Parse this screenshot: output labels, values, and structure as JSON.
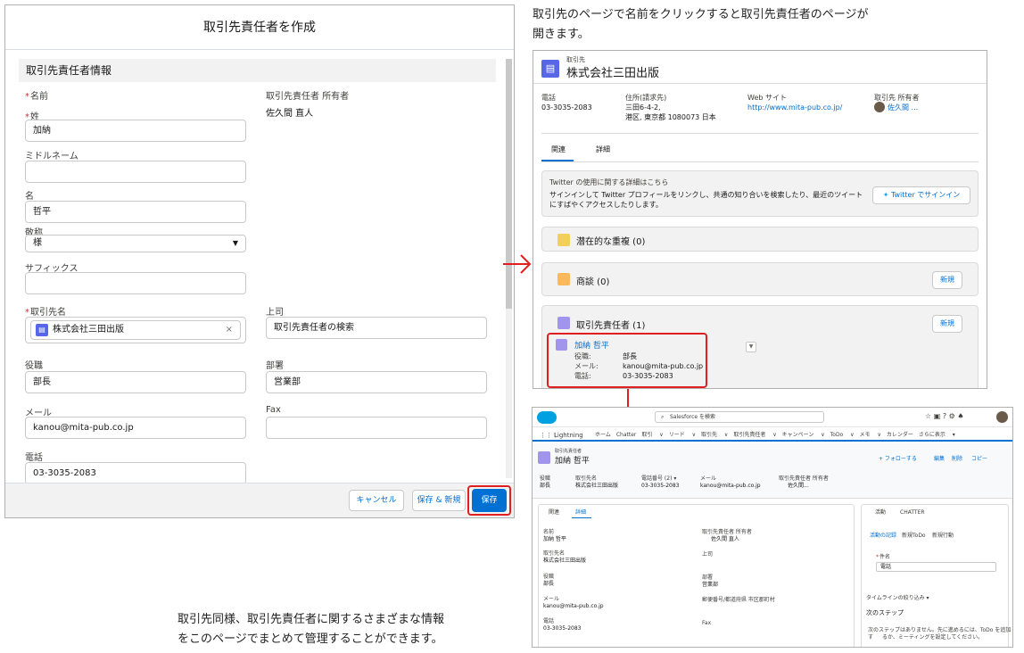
{
  "modal": {
    "title": "取引先責任者を作成",
    "section": "取引先責任者情報",
    "name_label": "名前",
    "last_name_label": "姓",
    "last_name_value": "加納",
    "middle_name_label": "ミドルネーム",
    "first_name_label": "名",
    "first_name_value": "哲平",
    "salutation_label": "敬称",
    "salutation_value": "様",
    "suffix_label": "サフィックス",
    "owner_label": "取引先責任者 所有者",
    "owner_value": "佐久間 直人",
    "account_label": "取引先名",
    "account_value": "株式会社三田出版",
    "boss_label": "上司",
    "boss_placeholder": "取引先責任者の検索",
    "title_label": "役職",
    "title_value": "部長",
    "dept_label": "部署",
    "dept_value": "営業部",
    "email_label": "メール",
    "email_value": "kanou@mita-pub.co.jp",
    "fax_label": "Fax",
    "phone_label": "電話",
    "phone_value": "03-3035-2083",
    "cancel": "キャンセル",
    "save_new": "保存 & 新規",
    "save": "保存"
  },
  "notes": {
    "top_line1": "取引先のページで名前をクリックすると取引先責任者のページが",
    "top_line2": "開きます。",
    "bottom_line1": "取引先同様、取引先責任者に関するさまざまな情報",
    "bottom_line2": "をこのページでまとめて管理することができます。"
  },
  "account": {
    "type": "取引先",
    "name": "株式会社三田出版",
    "phone_label": "電話",
    "phone": "03-3035-2083",
    "address_label": "住所(請求先)",
    "address1": "三田6-4-2,",
    "address2": "港区, 東京都 1080073 日本",
    "web_label": "Web サイト",
    "web": "http://www.mita-pub.co.jp/",
    "owner_label": "取引先 所有者",
    "owner": "佐久間 ...",
    "tab_related": "関連",
    "tab_detail": "詳細",
    "twitter_title": "Twitter の使用に関する詳細はこちら",
    "twitter_text1": "サインインして Twitter プロフィールをリンクし、共通の知り合いを検索したり、最近のツイート",
    "twitter_text2": "にすばやくアクセスしたりします。",
    "twitter_btn": "Twitter でサインイン",
    "dup": "潜在的な重複 (0)",
    "opp": "商談 (0)",
    "new": "新規",
    "contacts": "取引先責任者 (1)",
    "contact_name": "加納 哲平",
    "c_title_label": "役職:",
    "c_title": "部長",
    "c_mail_label": "メール:",
    "c_mail": "kanou@mita-pub.co.jp",
    "c_phone_label": "電話:",
    "c_phone": "03-3035-2083"
  },
  "contact": {
    "search": "Salesforce を検索",
    "app": "Lightning",
    "nav": [
      "ホーム",
      "Chatter",
      "取引 ∨",
      "リード ∨",
      "取引先 ∨",
      "取引先責任者 ∨",
      "キャンペーン ∨",
      "ToDo ∨",
      "メモ ∨",
      "カレンダー",
      "さらに表示 ▾"
    ],
    "type": "取引先責任者",
    "name": "加納 哲平",
    "follow": "+ フォローする",
    "edit": "編集",
    "delete": "削除",
    "copy": "コピー",
    "h_title_label": "役職",
    "h_title": "部長",
    "h_acct_label": "取引先名",
    "h_acct": "株式会社三田出版",
    "h_phone_label": "電話番号 (2) ▾",
    "h_phone": "03-3035-2083",
    "h_mail_label": "メール",
    "h_mail": "kanou@mita-pub.co.jp",
    "h_owner_label": "取引先責任者 所有者",
    "h_owner": "佐久間...",
    "tab_related": "関連",
    "tab_detail": "詳細",
    "f_name_label": "名前",
    "f_name": "加納 哲平",
    "f_acct_label": "取引先名",
    "f_acct": "株式会社三田出版",
    "f_title_label": "役職",
    "f_title": "部長",
    "f_mail_label": "メール",
    "f_mail": "kanou@mita-pub.co.jp",
    "f_phone_label": "電話",
    "f_phone": "03-3035-2083",
    "f_owner_label": "取引先責任者 所有者",
    "f_owner": "佐久間 直人",
    "f_boss_label": "上司",
    "f_dept_label": "部署",
    "f_dept": "営業部",
    "f_fax_label": "Fax",
    "f_address": "郵便番号/都道府県 市区郡町村",
    "act_tab": "活動",
    "chatter_tab": "CHATTER",
    "act_sub1": "活動の記録",
    "act_sub2": "新規ToDo",
    "act_sub3": "新規行動",
    "subject_label": "件名",
    "subject": "電話",
    "timeline": "タイムラインの絞り込み ▾",
    "next_steps": "次のステップ",
    "empty1": "次のステップはありません。先に進めるには、ToDo を追加す",
    "empty2": "るか、ミーティングを設定してください。"
  },
  "colors": {
    "accent": "#0070d2",
    "highlight": "#e02020",
    "account_icon": "#5867e8"
  }
}
